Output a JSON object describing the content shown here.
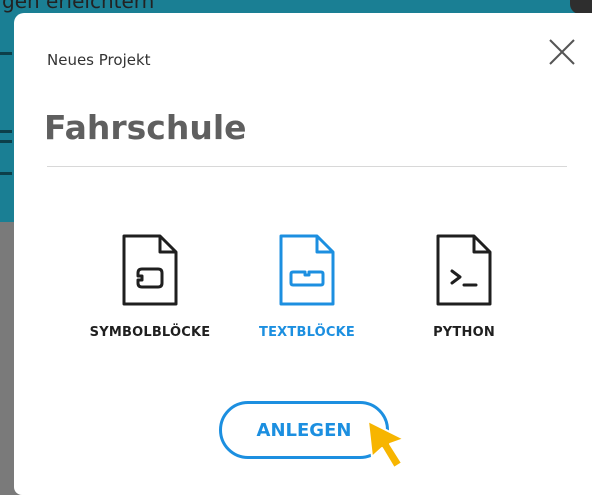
{
  "background": {
    "partial_text": "gen erleichtern"
  },
  "dialog": {
    "title": "Neues Projekt",
    "project_name_value": "Fahrschule",
    "close_icon": "close-icon",
    "options": [
      {
        "label": "SYMBOLBLÖCKE",
        "icon": "file-blocks-icon",
        "selected": false
      },
      {
        "label": "TEXTBLÖCKE",
        "icon": "file-textblocks-icon",
        "selected": true
      },
      {
        "label": "PYTHON",
        "icon": "file-python-icon",
        "selected": false
      }
    ],
    "create_label": "ANLEGEN"
  },
  "colors": {
    "accent": "#1c8fe0",
    "text_dark": "#1f1f1f",
    "background_teal": "#1a7f94",
    "cursor": "#f7b500"
  }
}
